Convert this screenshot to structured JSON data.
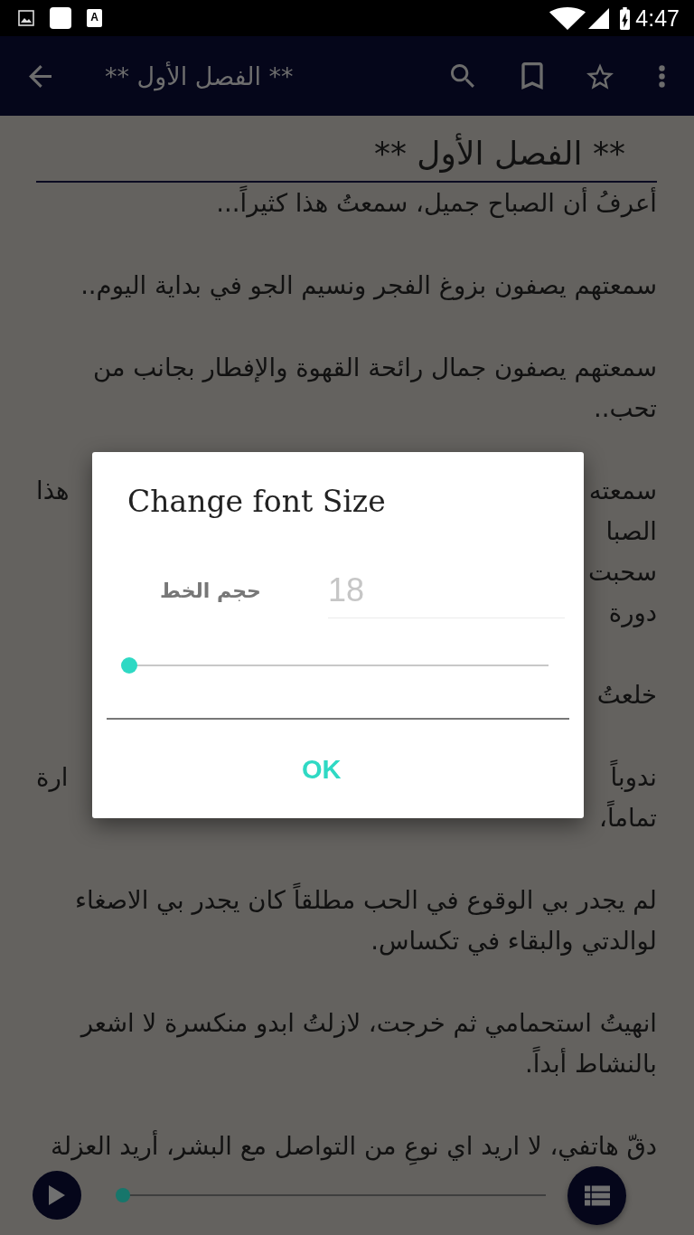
{
  "status_bar": {
    "notification_letter": "A",
    "time": "4:47"
  },
  "app_bar": {
    "title": "** الفصل الأول **"
  },
  "chapter": {
    "heading": "** الفصل الأول **",
    "blocks": [
      {
        "kind": "paragraph",
        "text": "أعرفُ أن الصباح جميل، سمعتُ هذا كثيراً..."
      },
      {
        "kind": "paragraph",
        "text": "سمعتهم يصفون بزوغ الفجر ونسيم الجو في بداية اليوم.."
      },
      {
        "kind": "paragraph",
        "text": "سمعتهم يصفون جمال رائحة القهوة والإفطار بجانب من تحب.."
      },
      {
        "kind": "covered",
        "lines": [
          {
            "right": "سمعته",
            "left": "هذا"
          },
          {
            "right": "الصبا"
          },
          {
            "right": "سحبت"
          },
          {
            "right": "دورة"
          }
        ]
      },
      {
        "kind": "covered",
        "lines": [
          {
            "right": "خلعتُ"
          }
        ]
      },
      {
        "kind": "covered",
        "lines": [
          {
            "right": "ندوباً",
            "left": "ارة"
          },
          {
            "right": "تماماً،"
          }
        ]
      },
      {
        "kind": "paragraph",
        "text": "لم يجدر بي الوقوع في الحب مطلقاً كان يجدر بي الاصغاء لوالدتي والبقاء في تكساس."
      },
      {
        "kind": "paragraph",
        "text": "انهيتُ استحمامي ثم خرجت، لازلتُ ابدو منكسرة لا اشعر بالنشاط أبداً."
      },
      {
        "kind": "paragraph",
        "text": "دقّ هاتفي، لا اريد اي نوعِ من التواصل مع البشر، أريد العزلة"
      }
    ]
  },
  "player": {
    "level": 0
  },
  "dialog": {
    "title": "Change font Size",
    "label": "حجم الخط",
    "input": {
      "placeholder": "18"
    },
    "slider": {
      "level": 0
    },
    "buttons": [
      "OK"
    ]
  }
}
